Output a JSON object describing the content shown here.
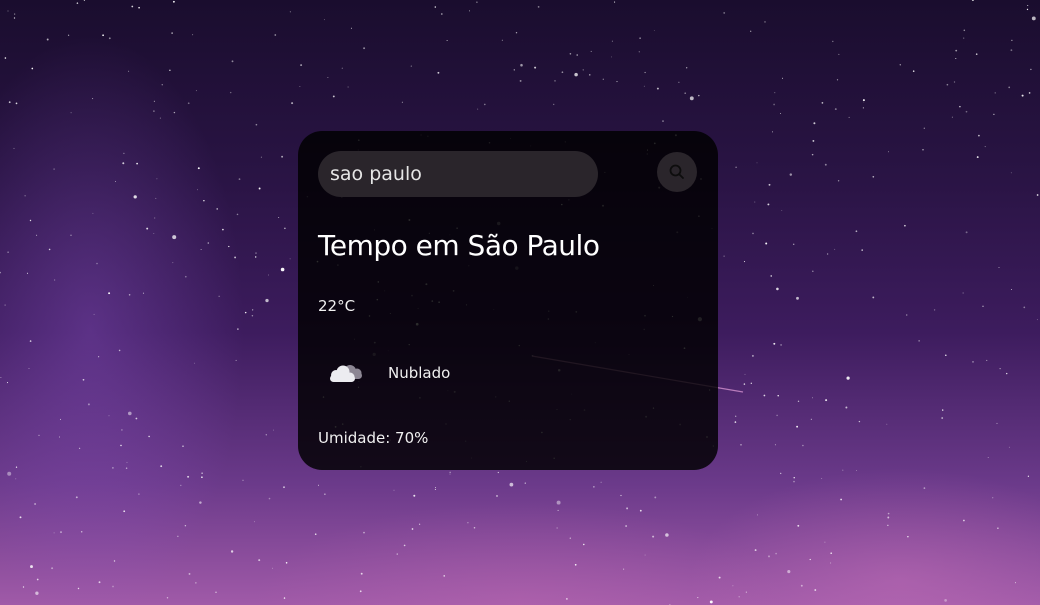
{
  "background": {
    "colors": [
      "#1a0d2e",
      "#3d1c5e",
      "#a05aa8"
    ]
  },
  "search": {
    "value": "sao paulo",
    "placeholder": ""
  },
  "weather": {
    "title": "Tempo em São Paulo",
    "temperature": "22°C",
    "description": "Nublado",
    "humidity": "Umidade: 70%",
    "icon": "cloud-icon"
  },
  "colors": {
    "card": "#000000",
    "input": "#2a252b",
    "text": "#ffffff"
  }
}
